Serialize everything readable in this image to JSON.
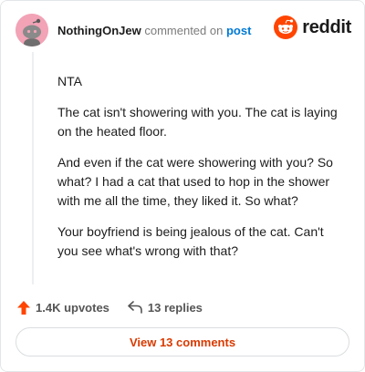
{
  "header": {
    "username": "NothingOnJew",
    "action_text": "commented on",
    "post_link": "post",
    "brand": "reddit"
  },
  "comment": {
    "paragraphs": [
      "NTA",
      "The cat isn't showering with you. The cat is laying on the heated floor.",
      "And even if the cat were showering with you? So what? I had a cat that used to hop in the shower with me all the time, they liked it. So what?",
      "Your boyfriend is being jealous of the cat. Can't you see what's wrong with that?"
    ]
  },
  "actions": {
    "upvotes": "1.4K upvotes",
    "replies": "13 replies"
  },
  "footer": {
    "view_comments": "View 13 comments"
  },
  "icons": {
    "avatar": "snoo-avatar-icon",
    "brand": "reddit-logo-icon",
    "upvote": "upvote-arrow-icon",
    "reply": "reply-arrow-icon"
  },
  "colors": {
    "brand_orange": "#ff4500",
    "link_blue": "#0079d3",
    "view_button_text": "#d93a00",
    "avatar_bg": "#f2a3b6"
  }
}
